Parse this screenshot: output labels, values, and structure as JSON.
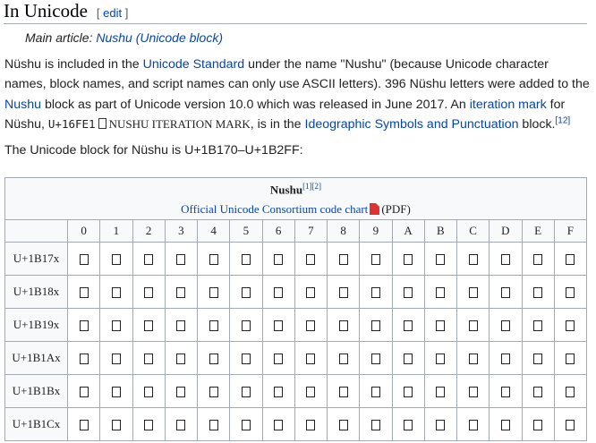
{
  "section": {
    "title": "In Unicode",
    "edit_open": "[ ",
    "edit_label": "edit",
    "edit_close": " ]"
  },
  "hatnote": {
    "prefix": "Main article: ",
    "link": "Nushu (Unicode block)"
  },
  "paragraph1": {
    "t1": "Nüshu is included in the ",
    "link_unicode_standard": "Unicode Standard",
    "t2": " under the name \"Nushu\" (because Unicode character names, block names, and script names can only use ASCII letters). 396 Nüshu letters were added to the ",
    "link_nushu": "Nushu",
    "t3": " block as part of Unicode version 10.0 which was released in June 2017. An ",
    "link_iteration_mark": "iteration mark",
    "t4": " for Nüshu, ",
    "code": "U+16FE1",
    "name": "NUSHU ITERATION MARK",
    "t5": ", is in the ",
    "link_ideographic": "Ideographic Symbols and Punctuation",
    "t6": " block.",
    "ref": "[12]"
  },
  "paragraph2": {
    "text": "The Unicode block for Nüshu is U+1B170–U+1B2FF:"
  },
  "code_chart": {
    "title": "Nushu",
    "ref1": "[1]",
    "ref2": "[2]",
    "chart_link": "Official Unicode Consortium code chart",
    "pdf_label": "(PDF)",
    "columns": [
      "0",
      "1",
      "2",
      "3",
      "4",
      "5",
      "6",
      "7",
      "8",
      "9",
      "A",
      "B",
      "C",
      "D",
      "E",
      "F"
    ],
    "rows": [
      "U+1B17x",
      "U+1B18x",
      "U+1B19x",
      "U+1B1Ax",
      "U+1B1Bx",
      "U+1B1Cx"
    ]
  }
}
